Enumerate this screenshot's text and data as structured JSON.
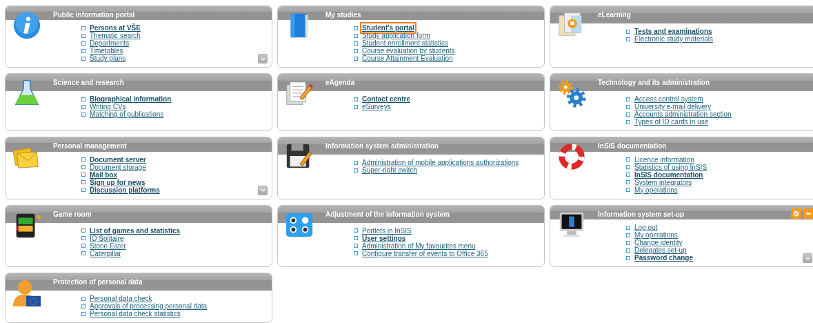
{
  "panels": [
    {
      "title": "Public information portal",
      "expand_button": true,
      "header_buttons": false,
      "links": [
        {
          "text": "Persons at VŠE",
          "bold": true,
          "highlighted": false
        },
        {
          "text": "Thematic search",
          "bold": false,
          "highlighted": false
        },
        {
          "text": "Departments",
          "bold": false,
          "highlighted": false
        },
        {
          "text": "Timetables",
          "bold": false,
          "highlighted": false
        },
        {
          "text": "Study plans",
          "bold": false,
          "highlighted": false
        }
      ]
    },
    {
      "title": "My studies",
      "expand_button": false,
      "header_buttons": false,
      "links": [
        {
          "text": "Student's portal",
          "bold": true,
          "highlighted": true
        },
        {
          "text": "Study application form",
          "bold": false,
          "highlighted": false
        },
        {
          "text": "Student enrollment statistics",
          "bold": false,
          "highlighted": false
        },
        {
          "text": "Course evaluation by students",
          "bold": false,
          "highlighted": false
        },
        {
          "text": "Course Attainment Evaluation",
          "bold": false,
          "highlighted": false
        }
      ]
    },
    {
      "title": "eLearning",
      "expand_button": false,
      "header_buttons": false,
      "links": [
        {
          "text": "Tests and examinations",
          "bold": true,
          "highlighted": false
        },
        {
          "text": "Electronic study materials",
          "bold": false,
          "highlighted": false
        }
      ]
    },
    {
      "title": "Science and research",
      "expand_button": false,
      "header_buttons": false,
      "links": [
        {
          "text": "Biographical information",
          "bold": true,
          "highlighted": false
        },
        {
          "text": "Writing CVs",
          "bold": false,
          "highlighted": false
        },
        {
          "text": "Matching of publications",
          "bold": false,
          "highlighted": false
        }
      ]
    },
    {
      "title": "eAgenda",
      "expand_button": false,
      "header_buttons": false,
      "links": [
        {
          "text": "Contact centre",
          "bold": true,
          "highlighted": false
        },
        {
          "text": "eSurveys",
          "bold": false,
          "highlighted": false
        }
      ]
    },
    {
      "title": "Technology and its administration",
      "expand_button": false,
      "header_buttons": false,
      "links": [
        {
          "text": "Access control system",
          "bold": false,
          "highlighted": false
        },
        {
          "text": "University e-mail delivery",
          "bold": false,
          "highlighted": false
        },
        {
          "text": "Accounts administration section",
          "bold": false,
          "highlighted": false
        },
        {
          "text": "Types of ID cards in use",
          "bold": false,
          "highlighted": false
        }
      ]
    },
    {
      "title": "Personal management",
      "expand_button": true,
      "header_buttons": false,
      "links": [
        {
          "text": "Document server",
          "bold": true,
          "highlighted": false
        },
        {
          "text": "Document storage",
          "bold": false,
          "highlighted": false
        },
        {
          "text": "Mail box",
          "bold": true,
          "highlighted": false
        },
        {
          "text": "Sign up for news",
          "bold": true,
          "highlighted": false
        },
        {
          "text": "Discussion platforms",
          "bold": true,
          "highlighted": false
        }
      ]
    },
    {
      "title": "Information system administration",
      "expand_button": false,
      "header_buttons": false,
      "links": [
        {
          "text": "Administration of mobile applications authorizations",
          "bold": false,
          "highlighted": false
        },
        {
          "text": "Super-right switch",
          "bold": false,
          "highlighted": false
        }
      ]
    },
    {
      "title": "InSIS documentation",
      "expand_button": false,
      "header_buttons": false,
      "links": [
        {
          "text": "Licence information",
          "bold": false,
          "highlighted": false
        },
        {
          "text": "Statistics of using InSIS",
          "bold": false,
          "highlighted": false
        },
        {
          "text": "InSIS documentation",
          "bold": true,
          "highlighted": false
        },
        {
          "text": "System integrators",
          "bold": false,
          "highlighted": false
        },
        {
          "text": "My operations",
          "bold": false,
          "highlighted": false
        }
      ]
    },
    {
      "title": "Game room",
      "expand_button": false,
      "header_buttons": false,
      "links": [
        {
          "text": "List of games and statistics",
          "bold": true,
          "highlighted": false
        },
        {
          "text": "IQ Solitaire",
          "bold": false,
          "highlighted": false
        },
        {
          "text": "Stone Eater",
          "bold": false,
          "highlighted": false
        },
        {
          "text": "Caterpillar",
          "bold": false,
          "highlighted": false
        }
      ]
    },
    {
      "title": "Adjustment of the information system",
      "expand_button": false,
      "header_buttons": false,
      "links": [
        {
          "text": "Portlets in InSIS",
          "bold": false,
          "highlighted": false
        },
        {
          "text": "User settings",
          "bold": true,
          "highlighted": false
        },
        {
          "text": "Administration of My favourites menu",
          "bold": false,
          "highlighted": false
        },
        {
          "text": "Configure transfer of events to Office 365",
          "bold": false,
          "highlighted": false
        }
      ]
    },
    {
      "title": "Information system set-up",
      "expand_button": true,
      "header_buttons": true,
      "links": [
        {
          "text": "Log out",
          "bold": false,
          "highlighted": false
        },
        {
          "text": "My operations",
          "bold": false,
          "highlighted": false
        },
        {
          "text": "Change identity",
          "bold": false,
          "highlighted": false
        },
        {
          "text": "Delegates set-up",
          "bold": false,
          "highlighted": false
        },
        {
          "text": "Password change",
          "bold": true,
          "highlighted": false
        }
      ]
    },
    {
      "title": "Protection of personal data",
      "expand_button": false,
      "header_buttons": false,
      "links": [
        {
          "text": "Personal data check",
          "bold": false,
          "highlighted": false
        },
        {
          "text": "Approvals of processing personal data",
          "bold": false,
          "highlighted": false
        },
        {
          "text": "Personal data check statistics",
          "bold": false,
          "highlighted": false
        }
      ]
    }
  ]
}
